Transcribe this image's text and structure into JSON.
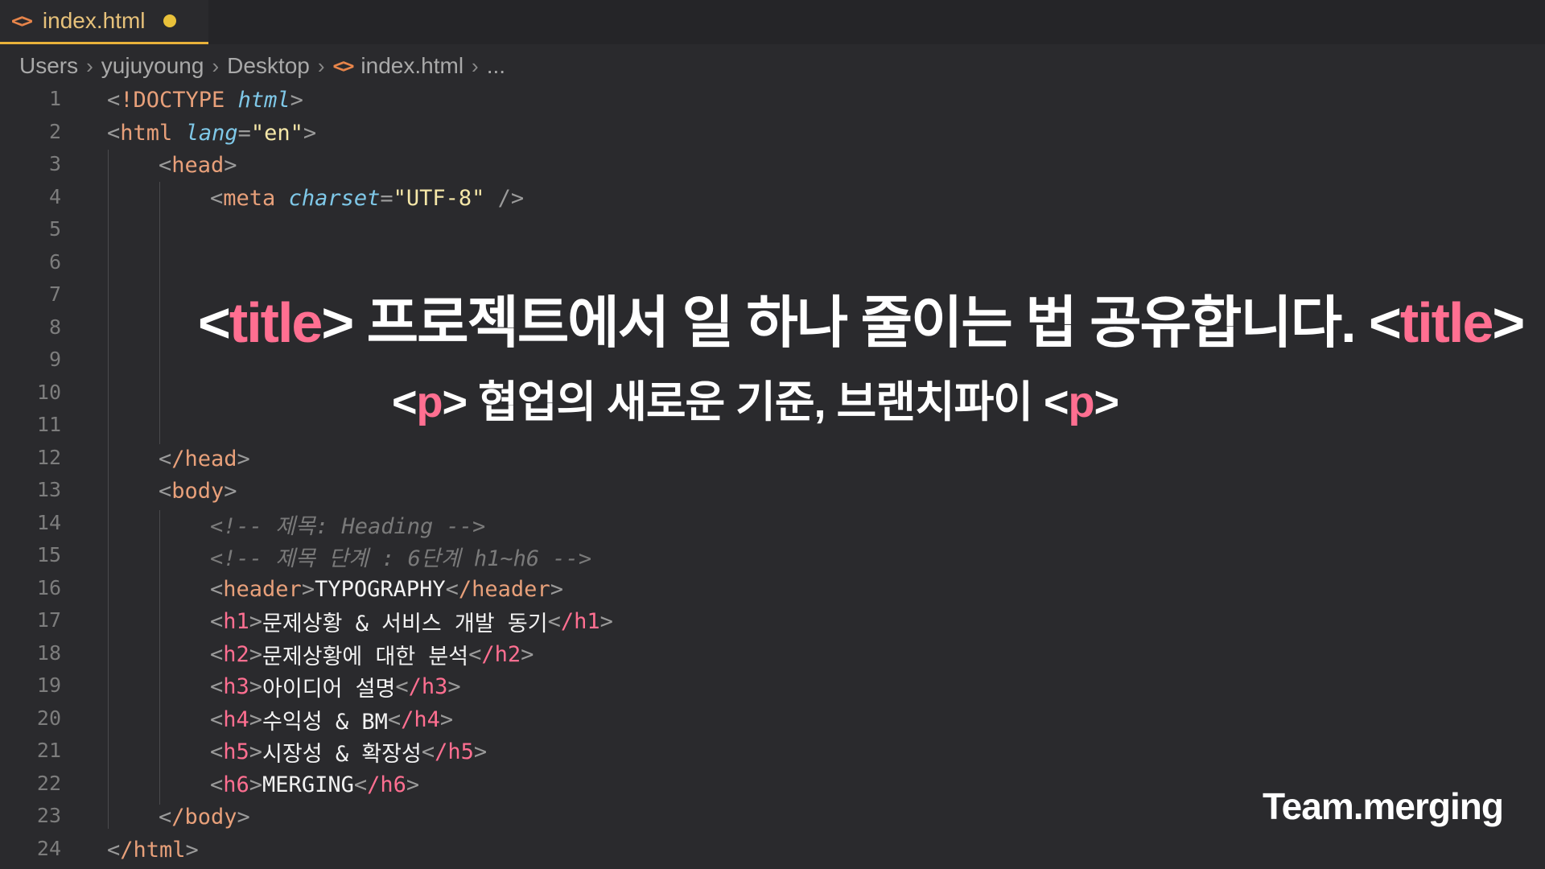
{
  "tab": {
    "filename": "index.html",
    "icon": "code-file-icon",
    "modified": true,
    "accent": "#e9b23a"
  },
  "breadcrumb": [
    "Users",
    "yujuyoung",
    "Desktop",
    "index.html",
    "..."
  ],
  "lines": [
    "1",
    "2",
    "3",
    "4",
    "5",
    "6",
    "7",
    "8",
    "9",
    "10",
    "11",
    "12",
    "13",
    "14",
    "15",
    "16",
    "17",
    "18",
    "19",
    "20",
    "21",
    "22",
    "23",
    "24"
  ],
  "code": {
    "l1_doctype": "!DOCTYPE",
    "l1_html": "html",
    "l2_tag": "html",
    "l2_attr": "lang",
    "l2_val": "\"en\"",
    "l3_tag": "head",
    "l4_tag": "meta",
    "l4_attr": "charset",
    "l4_val": "\"UTF-8\"",
    "l12_tag": "/head",
    "l13_tag": "body",
    "l14_comment": "<!-- 제목: Heading -->",
    "l15_comment": "<!-- 제목 단계 : 6단계 h1~h6 -->",
    "l16_tag": "header",
    "l16_text": "TYPOGRAPHY",
    "l16_close": "/header",
    "l17_tag": "h1",
    "l17_text": "문제상황 & 서비스 개발 동기",
    "l17_close": "/h1",
    "l18_tag": "h2",
    "l18_text": "문제상황에 대한 분석",
    "l18_close": "/h2",
    "l19_tag": "h3",
    "l19_text": "아이디어 설명",
    "l19_close": "/h3",
    "l20_tag": "h4",
    "l20_text": "수익성 & BM",
    "l20_close": "/h4",
    "l21_tag": "h5",
    "l21_text": "시장성 & 확장성",
    "l21_close": "/h5",
    "l22_tag": "h6",
    "l22_text": "MERGING",
    "l22_close": "/h6",
    "l23_tag": "/body",
    "l24_tag": "/html"
  },
  "overlay": {
    "title_open": "<title>",
    "title_text": " 프로젝트에서 일 하나 줄이는 법 공유합니다. ",
    "title_close": "<title>",
    "p_open": "<p>",
    "p_text": " 협업의 새로운 기준, 브랜치파이 ",
    "p_close": "<p>",
    "brand": "Team.merging"
  }
}
